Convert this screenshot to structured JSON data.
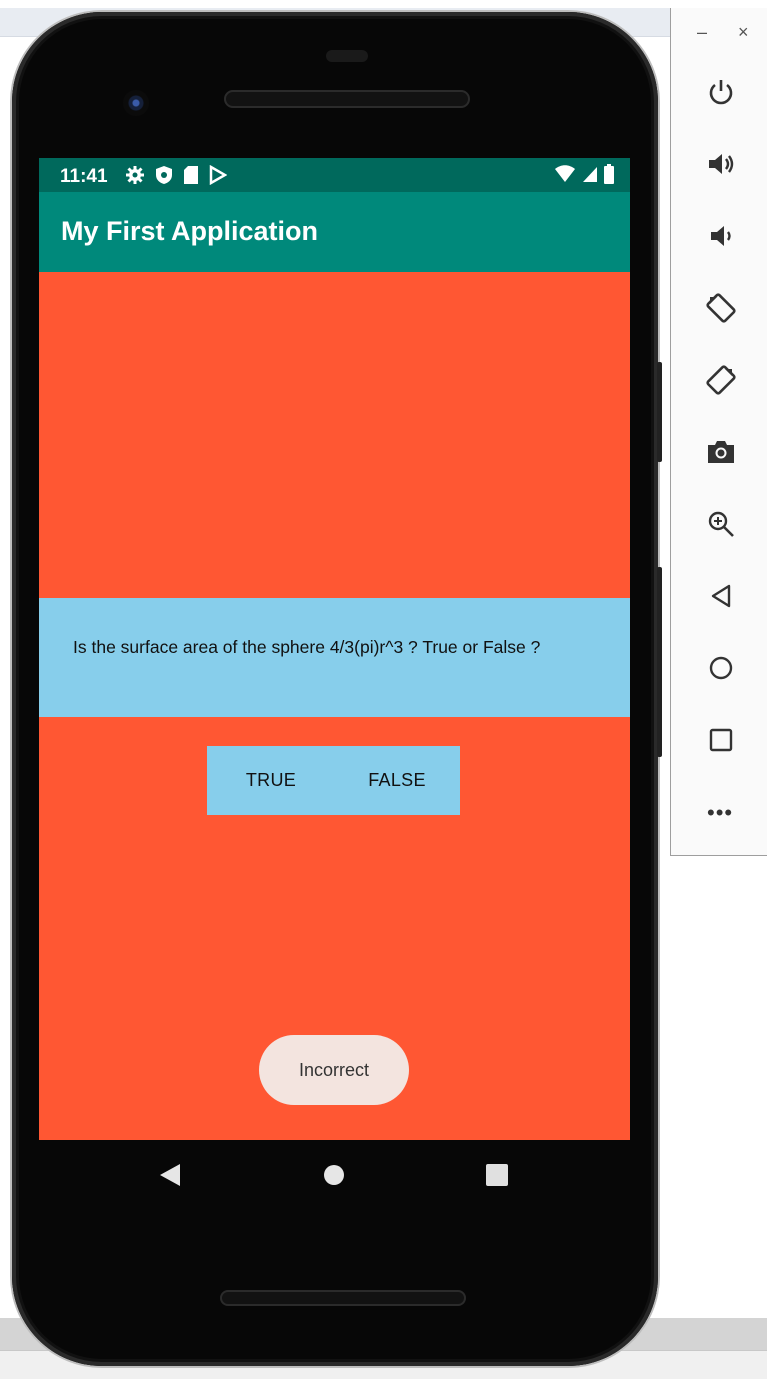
{
  "status_bar": {
    "time": "11:41"
  },
  "app": {
    "title": "My First Application"
  },
  "question": {
    "text": "Is the surface area of the sphere 4/3(pi)r^3 ? True or False ?"
  },
  "buttons": {
    "true_label": "TRUE",
    "false_label": "FALSE"
  },
  "toast": {
    "message": "Incorrect"
  },
  "emulator_panel": {
    "minimize": "–",
    "close": "×",
    "more": "•••",
    "tools": [
      "power-icon",
      "volume-up-icon",
      "volume-down-icon",
      "rotate-left-icon",
      "rotate-right-icon",
      "camera-icon",
      "zoom-icon",
      "back-icon",
      "home-icon",
      "overview-icon"
    ]
  },
  "colors": {
    "status_bar": "#00695c",
    "app_bar": "#00897B",
    "background": "#FF5733",
    "question_box": "#87CEEB",
    "buttons": "#87CEEB",
    "toast": "#f3e4df"
  }
}
